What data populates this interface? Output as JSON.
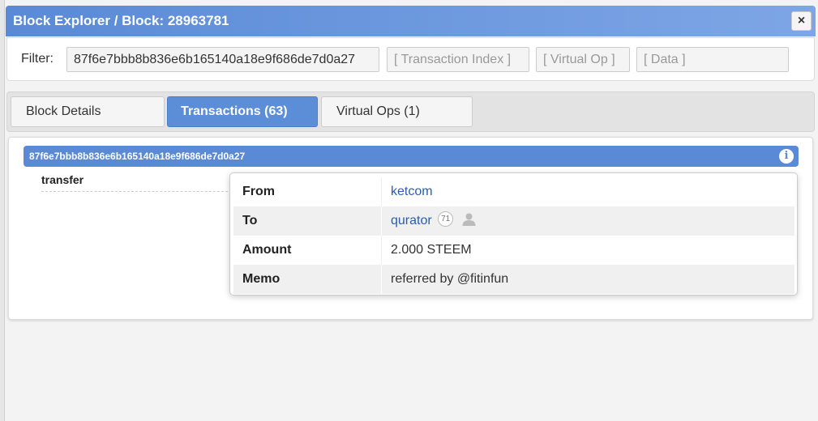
{
  "window": {
    "title": "Block Explorer / Block: 28963781",
    "close_label": "×"
  },
  "filter": {
    "label": "Filter:",
    "transaction_id_value": "87f6e7bbb8b836e6b165140a18e9f686de7d0a27",
    "transaction_index_placeholder": "[ Transaction Index ]",
    "virtual_op_placeholder": "[ Virtual Op ]",
    "data_placeholder": "[ Data ]"
  },
  "tabs": [
    {
      "label": "Block Details",
      "active": false
    },
    {
      "label": "Transactions (63)",
      "active": true
    },
    {
      "label": "Virtual Ops (1)",
      "active": false
    }
  ],
  "transaction": {
    "id": "87f6e7bbb8b836e6b165140a18e9f686de7d0a27",
    "info_icon": "i",
    "op_type": "transfer"
  },
  "details": {
    "from_key": "From",
    "from_value": "ketcom",
    "to_key": "To",
    "to_value": "qurator",
    "to_reputation": "71",
    "amount_key": "Amount",
    "amount_value": "2.000 STEEM",
    "memo_key": "Memo",
    "memo_value": "referred by @fitinfun"
  },
  "colors": {
    "accent": "#5a8ad6",
    "link": "#2a5db0"
  },
  "icons": [
    "close-icon",
    "info-icon",
    "user-icon"
  ]
}
